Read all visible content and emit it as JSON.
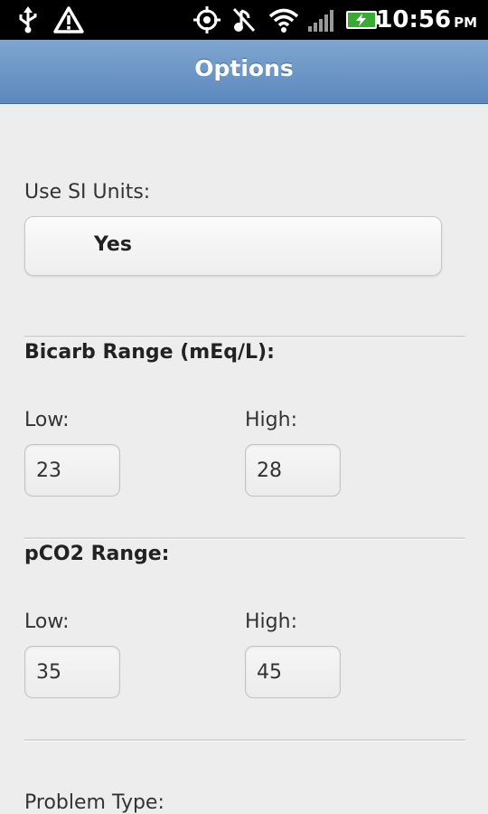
{
  "status_bar": {
    "time": "10:56",
    "ampm": "PM",
    "icons": [
      "usb-icon",
      "warning-icon",
      "gps-icon",
      "no-sound-icon",
      "wifi-icon",
      "signal-icon",
      "battery-charging-icon"
    ]
  },
  "title_bar": {
    "title": "Options"
  },
  "options": {
    "si_units": {
      "label": "Use SI Units:",
      "value": "Yes"
    },
    "bicarb": {
      "title": "Bicarb Range (mEq/L):",
      "low_label": "Low:",
      "low_value": "23",
      "high_label": "High:",
      "high_value": "28"
    },
    "pco2": {
      "title": "pCO2 Range:",
      "low_label": "Low:",
      "low_value": "35",
      "high_label": "High:",
      "high_value": "45"
    },
    "problem_type": {
      "label": "Problem Type:"
    }
  },
  "colors": {
    "title_bar": "#6b95c6",
    "background": "#ececec",
    "status_bar": "#000000"
  }
}
